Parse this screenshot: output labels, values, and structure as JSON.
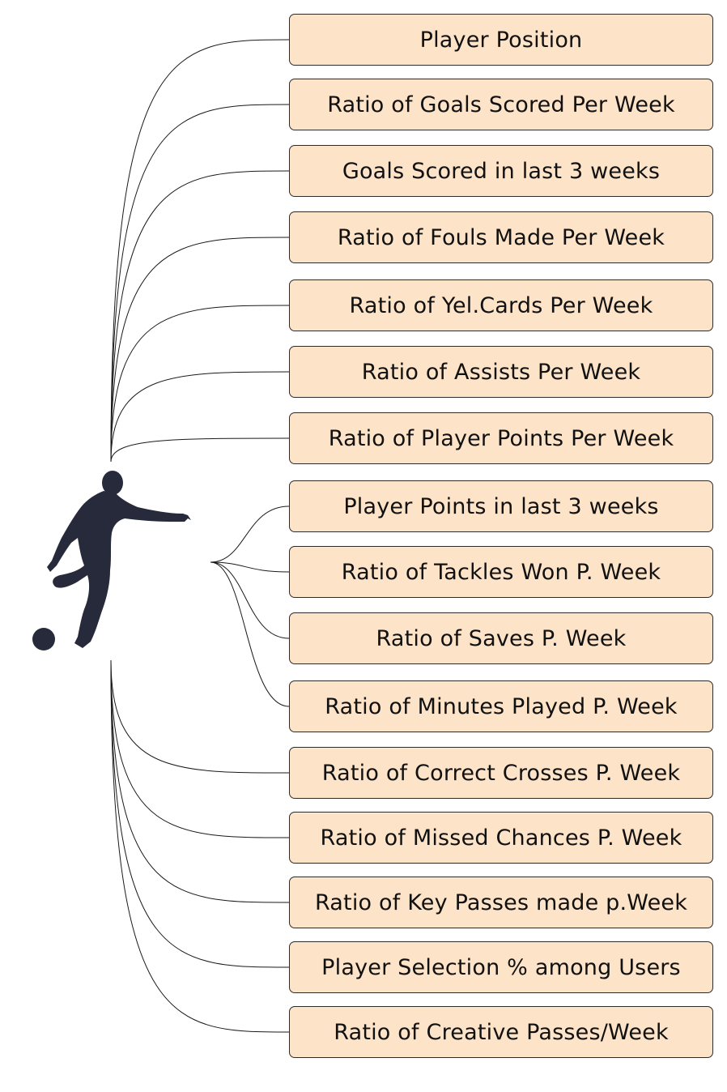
{
  "features": [
    {
      "label": "Player Position",
      "group": "upper"
    },
    {
      "label": "Ratio of Goals Scored Per Week",
      "group": "upper"
    },
    {
      "label": "Goals Scored in last 3 weeks",
      "group": "upper"
    },
    {
      "label": "Ratio of Fouls Made Per Week",
      "group": "upper"
    },
    {
      "label": "Ratio of Yel.Cards Per Week",
      "group": "upper"
    },
    {
      "label": "Ratio of Assists Per Week",
      "group": "upper"
    },
    {
      "label": "Ratio of Player Points Per Week",
      "group": "upper"
    },
    {
      "label": "Player Points in last 3 weeks",
      "group": "middle"
    },
    {
      "label": "Ratio of Tackles Won P. Week",
      "group": "middle"
    },
    {
      "label": "Ratio of Saves P. Week",
      "group": "middle"
    },
    {
      "label": "Ratio of Minutes Played P. Week",
      "group": "middle"
    },
    {
      "label": "Ratio of Correct Crosses P. Week",
      "group": "lower"
    },
    {
      "label": "Ratio of Missed Chances P. Week",
      "group": "lower"
    },
    {
      "label": "Ratio of Key Passes made p.Week",
      "group": "lower"
    },
    {
      "label": "Player Selection % among Users",
      "group": "lower"
    },
    {
      "label": "Ratio of Creative Passes/Week",
      "group": "lower"
    }
  ],
  "colors": {
    "box_fill": "#fde3c8",
    "box_border": "#2b2b2b",
    "connector": "#1a1a1a",
    "silhouette": "#262a3a"
  },
  "icons": {
    "player": "football-player-kicking-icon",
    "ball": "football-icon"
  }
}
